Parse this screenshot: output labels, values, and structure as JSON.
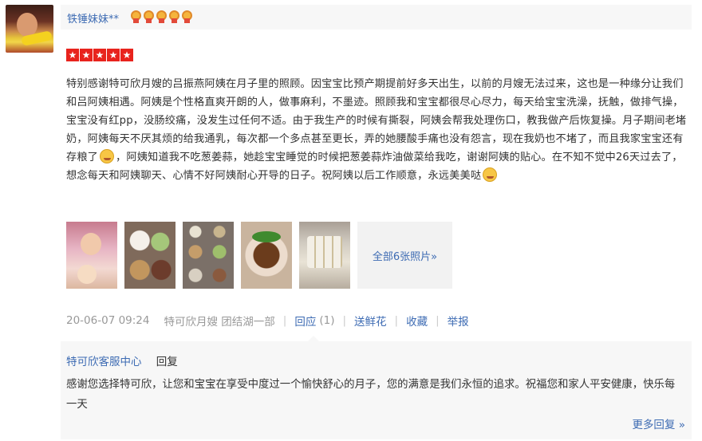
{
  "user": {
    "name": "铁锤妹妹**",
    "medal_count": 5
  },
  "rating": {
    "stars": 5,
    "max": 5
  },
  "review": {
    "text_part1": "特别感谢特可欣月嫂的吕振燕阿姨在月子里的照顾。因宝宝比预产期提前好多天出生，以前的月嫂无法过来，这也是一种缘分让我们和吕阿姨相遇。阿姨是个性格直爽开朗的人，做事麻利，不墨迹。照顾我和宝宝都很尽心尽力，每天给宝宝洗澡，抚触，做排气操，宝宝没有红pp，没肠绞痛，没发生过任何不适。由于我生产的时候有撕裂，阿姨会帮我处理伤口，教我做产后恢复操。月子期间老堵奶，阿姨每天不厌其烦的给我通乳，每次都一个多点甚至更长，弄的她腰酸手痛也没有怨言，现在我奶也不堵了，而且我家宝宝还有存粮了",
    "text_part2": "，阿姨知道我不吃葱姜蒜，她趁宝宝睡觉的时候把葱姜蒜炸油做菜给我吃，谢谢阿姨的贴心。在不知不觉中26天过去了，想念每天和阿姨聊天、心情不好阿姨耐心开导的日子。祝阿姨以后工作顺意，永远美美哒",
    "emoji_1": "smile-wink-emoji-icon",
    "emoji_2": "grin-emoji-icon"
  },
  "photos": {
    "thumbnails": [
      "photo-1",
      "photo-2",
      "photo-3",
      "photo-4",
      "photo-5"
    ],
    "all_label": "全部6张照片»"
  },
  "meta": {
    "date": "20-06-07 09:24",
    "source": "特可欣月嫂 团结湖一部",
    "reply_label": "回应",
    "reply_count": "(1)",
    "flower_label": "送鲜花",
    "collect_label": "收藏",
    "report_label": "举报"
  },
  "reply": {
    "author": "特可欣客服中心",
    "action": "回复",
    "text": "感谢您选择特可欣，让您和宝宝在享受中度过一个愉快舒心的月子，您的满意是我们永恒的追求。祝福您和家人平安健康，快乐每一天",
    "more_label": "更多回复 »"
  },
  "colors": {
    "link": "#3d6bb3",
    "star": "#e8231d",
    "muted": "#999999",
    "panel_bg": "#f7f7f7"
  }
}
